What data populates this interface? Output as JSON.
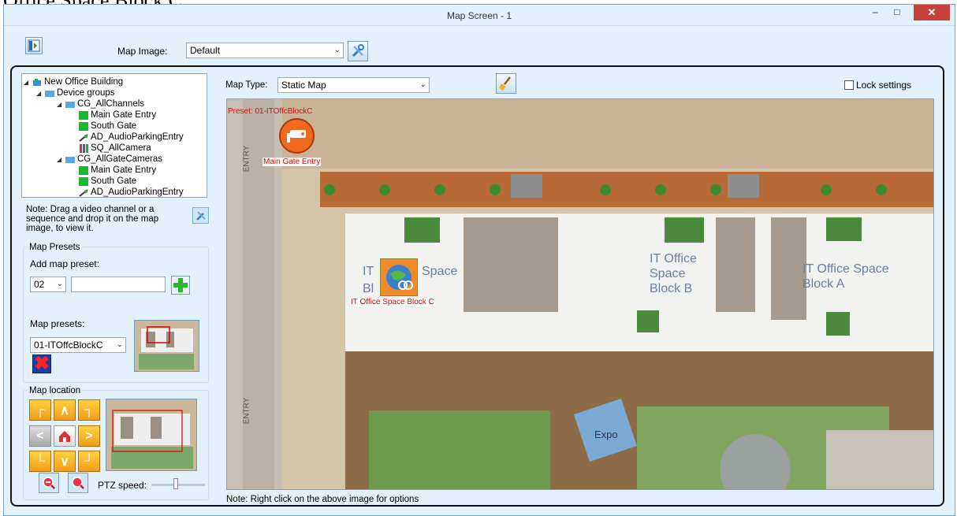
{
  "fragment": "Office Space Block C\".",
  "window": {
    "title": "Map Screen - 1"
  },
  "toolbar": {
    "map_image_label": "Map Image:",
    "map_image_value": "Default"
  },
  "tree": {
    "root": "New Office Building",
    "device_groups": "Device groups",
    "cg1": "CG_AllChannels",
    "cg1_items": [
      "Main Gate Entry",
      "South Gate",
      "AD_AudioParkingEntry",
      "SQ_AllCamera"
    ],
    "cg2": "CG_AllGateCameras",
    "cg2_items": [
      "Main Gate Entry",
      "South Gate",
      "AD_AudioParkingEntry"
    ]
  },
  "note_drag": "Note: Drag a video channel or a sequence and drop it on the map image, to view it.",
  "presets": {
    "group_title": "Map Presets",
    "add_label": "Add map preset:",
    "add_number": "02",
    "add_name": "",
    "list_label": "Map presets:",
    "selected": "01-ITOffcBlockC"
  },
  "location": {
    "group_title": "Map location",
    "ptz_label": "PTZ speed:",
    "ptz_speed": 0.45
  },
  "map": {
    "type_label": "Map Type:",
    "type_value": "Static Map",
    "lock_label": "Lock settings",
    "lock_checked": false,
    "preset_label": "Preset: 01-ITOffcBlockC",
    "camera_label": "Main Gate Entry",
    "block_label": "IT Office Space Block C",
    "note": "Note: Right click on the above image for options",
    "map_texts": {
      "entry1": "ENTRY",
      "entry2": "ENTRY",
      "blockb": "IT Office Space Block B",
      "blocka": "IT Office Space Block A",
      "blockc_part1": "IT",
      "blockc_part2": "Space",
      "blockc_part3": "Bl",
      "expo": "Expo"
    }
  },
  "colors": {
    "bg": "#e2f1fb",
    "accent_orange": "#f29c1a",
    "close_red": "#c7403a",
    "label_red": "#d01010"
  }
}
